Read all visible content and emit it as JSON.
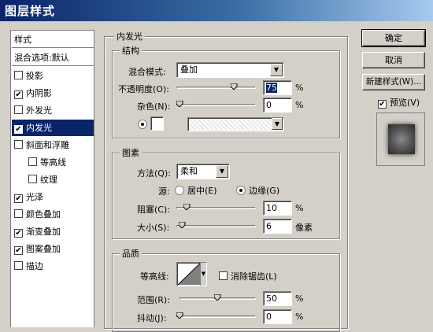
{
  "window": {
    "title": "图层样式"
  },
  "left_panel": {
    "header": "样式",
    "blend_default": "混合选项:默认",
    "items": [
      {
        "label": "投影",
        "checked": false,
        "indent": false,
        "selected": false
      },
      {
        "label": "内阴影",
        "checked": true,
        "indent": false,
        "selected": false
      },
      {
        "label": "外发光",
        "checked": false,
        "indent": false,
        "selected": false
      },
      {
        "label": "内发光",
        "checked": true,
        "indent": false,
        "selected": true
      },
      {
        "label": "斜面和浮雕",
        "checked": false,
        "indent": false,
        "selected": false
      },
      {
        "label": "等高线",
        "checked": false,
        "indent": true,
        "selected": false
      },
      {
        "label": "纹理",
        "checked": false,
        "indent": true,
        "selected": false
      },
      {
        "label": "光泽",
        "checked": true,
        "indent": false,
        "selected": false
      },
      {
        "label": "颜色叠加",
        "checked": false,
        "indent": false,
        "selected": false
      },
      {
        "label": "渐变叠加",
        "checked": true,
        "indent": false,
        "selected": false
      },
      {
        "label": "图案叠加",
        "checked": true,
        "indent": false,
        "selected": false
      },
      {
        "label": "描边",
        "checked": false,
        "indent": false,
        "selected": false
      }
    ]
  },
  "panel": {
    "title": "内发光",
    "structure": {
      "title": "结构",
      "blend_mode_label": "混合模式:",
      "blend_mode_value": "叠加",
      "opacity_label": "不透明度(O):",
      "opacity_value": "75",
      "opacity_unit": "%",
      "opacity_fraction": 0.75,
      "noise_label": "杂色(N):",
      "noise_value": "0",
      "noise_unit": "%",
      "noise_fraction": 0.0
    },
    "elements": {
      "title": "图素",
      "method_label": "方法(Q):",
      "method_value": "柔和",
      "source_label": "源:",
      "source_center": "居中(E)",
      "source_edge": "边缘(G)",
      "source_selected": "edge",
      "choke_label": "阻塞(C):",
      "choke_value": "10",
      "choke_unit": "%",
      "choke_fraction": 0.1,
      "size_label": "大小(S):",
      "size_value": "6",
      "size_unit": "像素",
      "size_fraction": 0.03
    },
    "quality": {
      "title": "品质",
      "contour_label": "等高线:",
      "antialias_label": "消除锯齿(L)",
      "antialias_checked": false,
      "range_label": "范围(R):",
      "range_value": "50",
      "range_unit": "%",
      "range_fraction": 0.5,
      "jitter_label": "抖动(J):",
      "jitter_value": "0",
      "jitter_unit": "%",
      "jitter_fraction": 0.0
    }
  },
  "buttons": {
    "ok": "确定",
    "cancel": "取消",
    "new_style": "新建样式(W)...",
    "preview_label": "预览(V)",
    "preview_checked": true
  }
}
